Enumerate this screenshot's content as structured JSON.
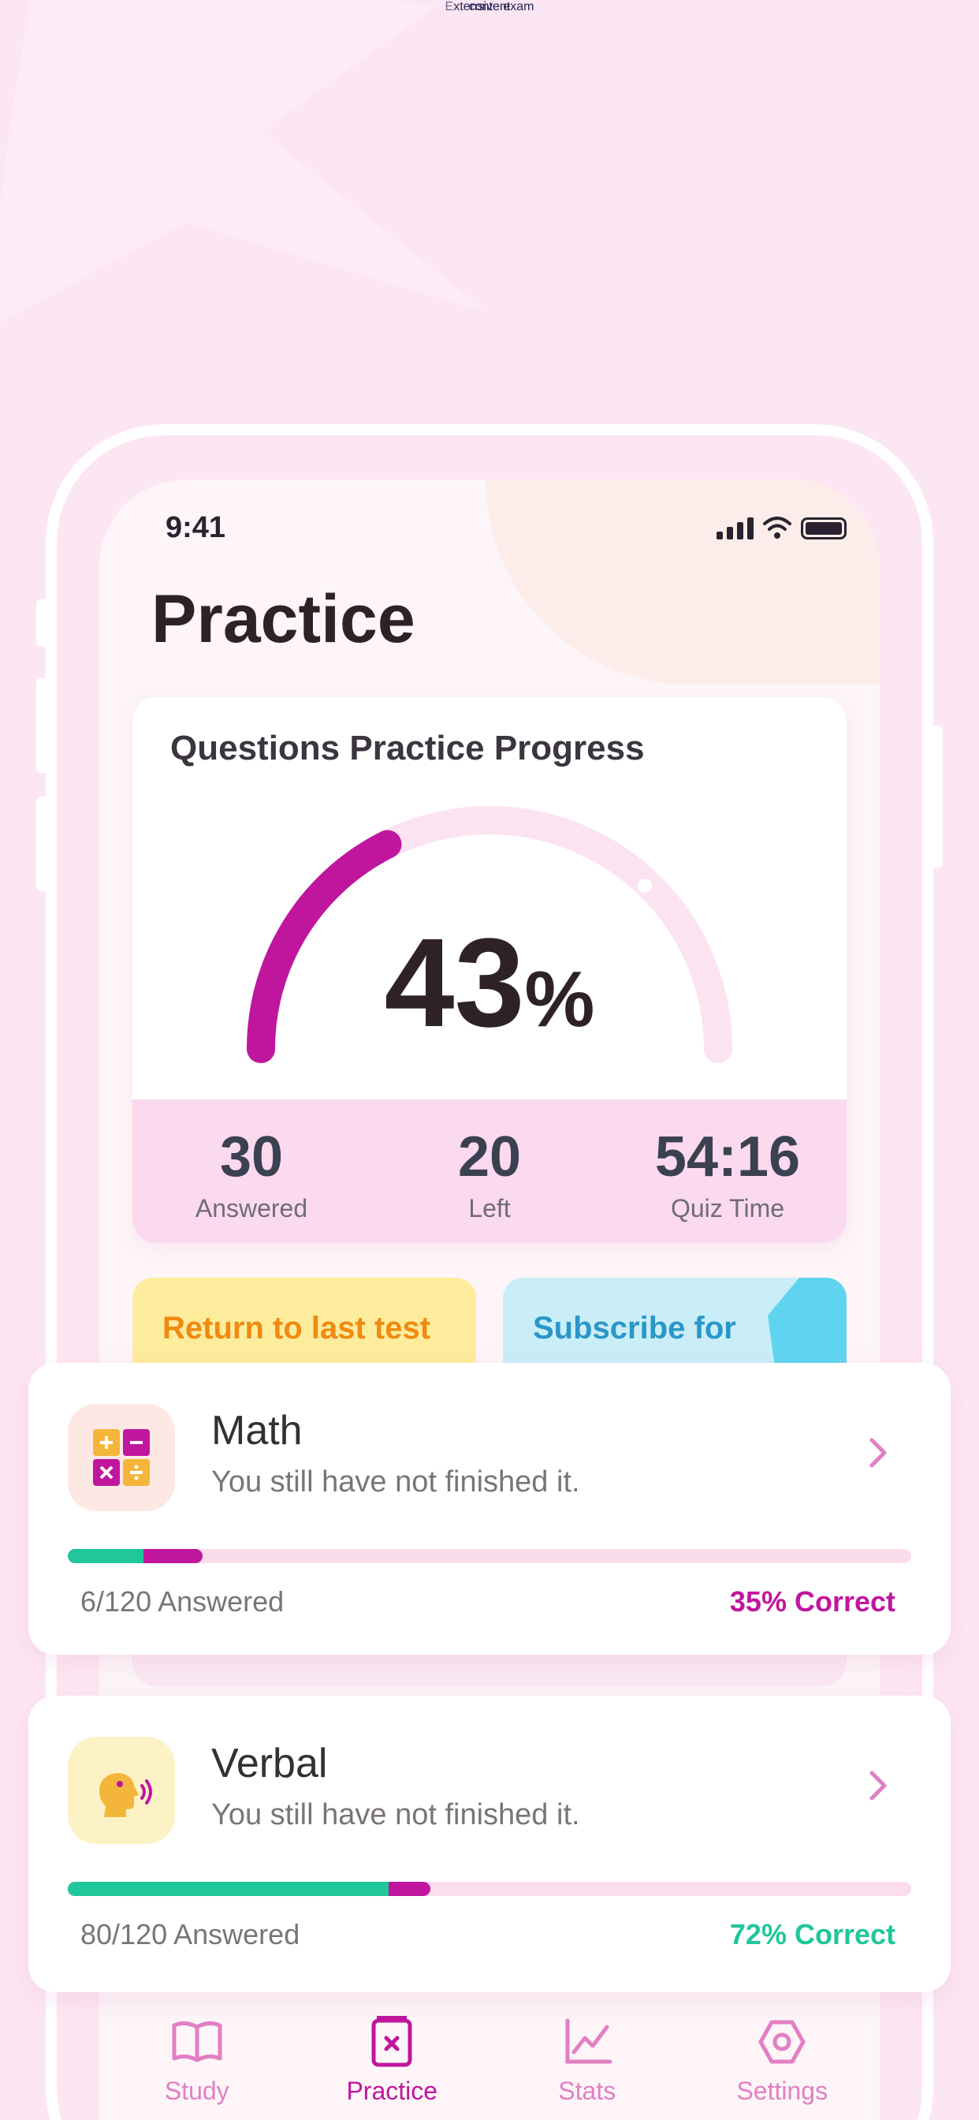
{
  "headline": {
    "line1": "Extensive exam",
    "line2": "content"
  },
  "status_bar": {
    "time": "9:41"
  },
  "screen": {
    "title": "Practice"
  },
  "progress_card": {
    "title": "Questions Practice Progress",
    "percent_value": "43",
    "percent_sign": "%",
    "progress_fraction": 0.43,
    "stats": [
      {
        "value": "30",
        "label": "Answered"
      },
      {
        "value": "20",
        "label": "Left"
      },
      {
        "value": "54:16",
        "label": "Quiz Time"
      }
    ]
  },
  "quick_actions": {
    "return_label": "Return to last test",
    "subscribe_label": "Subscribe for"
  },
  "hidden_row_text": "You still have not finished it.",
  "subjects": [
    {
      "name": "Math",
      "description": "You still have not finished it.",
      "answered_text": "6/120 Answered",
      "correct_text": "35% Correct",
      "correct_color": "#c0169e",
      "icon": "calculator-icon",
      "bar_total_fraction": 0.16,
      "bar_green_fraction": 0.09
    },
    {
      "name": "Verbal",
      "description": "You still have not finished it.",
      "answered_text": "80/120 Answered",
      "correct_text": "72% Correct",
      "correct_color": "#1fc79a",
      "icon": "speaking-head-icon",
      "bar_total_fraction": 0.43,
      "bar_green_fraction": 0.38
    }
  ],
  "tabbar": [
    {
      "label": "Study",
      "icon": "book-icon",
      "active": false
    },
    {
      "label": "Practice",
      "icon": "practice-icon",
      "active": true
    },
    {
      "label": "Stats",
      "icon": "chart-icon",
      "active": false
    },
    {
      "label": "Settings",
      "icon": "settings-icon",
      "active": false
    }
  ],
  "colors": {
    "background": "#fde6f3",
    "accent_magenta": "#c0169e",
    "accent_green": "#1fc79a",
    "headline": "#262655"
  }
}
